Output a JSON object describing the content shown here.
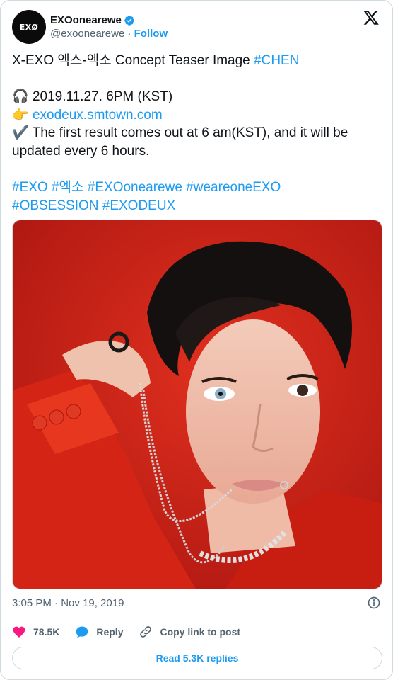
{
  "account": {
    "avatar_text": "EXØ",
    "display_name": "EXOonearewe",
    "handle": "@exoonearewe",
    "separator": "·",
    "follow_label": "Follow",
    "verified_color": "#1d9bf0"
  },
  "tweet": {
    "line1_prefix": "X-EXO 엑스-엑소 Concept Teaser Image ",
    "line1_hashtag": "#CHEN",
    "date_emoji": "🎧",
    "date_text": " 2019.11.27. 6PM (KST)",
    "link_emoji": "👉",
    "link_text": "exodeux.smtown.com",
    "check_emoji": "✔️",
    "result_text": " The first result comes out at 6 am(KST), and it will be updated every 6 hours.",
    "hashtags_line1": "#EXO #엑소 #EXOonearewe #weareoneEXO",
    "hashtags_line2": "#OBSESSION #EXODEUX"
  },
  "media": {
    "description": "",
    "background_color": "#c8201a"
  },
  "meta": {
    "timestamp": "3:05 PM · Nov 19, 2019"
  },
  "actions": {
    "like_count": "78.5K",
    "reply_label": "Reply",
    "copy_label": "Copy link to post",
    "read_replies_label": "Read 5.3K replies"
  },
  "colors": {
    "link": "#1d9bf0",
    "like": "#f91880",
    "muted": "#536471",
    "text": "#0f1419"
  }
}
